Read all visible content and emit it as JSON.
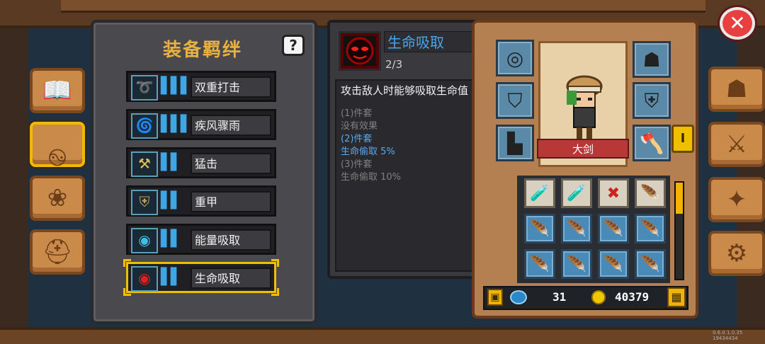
{
  "bond_panel": {
    "title": "装备羁绊",
    "help_label": "?",
    "bonds": [
      {
        "name": "双重打击",
        "icon": "bow-icon",
        "glyph": "➰",
        "bars": "▌▌▌",
        "color": "#e04030"
      },
      {
        "name": "疾风骤雨",
        "icon": "tornado-icon",
        "glyph": "🌀",
        "bars": "▌▌▌",
        "color": "#b060e0"
      },
      {
        "name": "猛击",
        "icon": "hammer-icon",
        "glyph": "⚒",
        "bars": "▌▌",
        "color": "#e0c060"
      },
      {
        "name": "重甲",
        "icon": "armor-icon",
        "glyph": "⛨",
        "bars": "▌▌",
        "color": "#c0a060"
      },
      {
        "name": "能量吸取",
        "icon": "energy-mask-icon",
        "glyph": "◉",
        "bars": "▌▌",
        "color": "#40c0e0"
      },
      {
        "name": "生命吸取",
        "icon": "life-mask-icon",
        "glyph": "◉",
        "bars": "▌▌",
        "color": "#e02020"
      }
    ],
    "selected_index": 5
  },
  "detail": {
    "name": "生命吸取",
    "count": "2/3",
    "description": "攻击敌人时能够吸取生命值",
    "tiers": [
      {
        "line": "(1)件套",
        "active": false
      },
      {
        "line": "没有效果",
        "active": false
      },
      {
        "line": "(2)件套",
        "active": true
      },
      {
        "line": "生命偷取 5%",
        "active": true
      },
      {
        "line": "(3)件套",
        "active": false
      },
      {
        "line": "生命偷取 10%",
        "active": false
      }
    ]
  },
  "hero": {
    "name": "大剑",
    "side_tab": "I"
  },
  "currency": {
    "gems": "31",
    "coins": "40379"
  },
  "close_label": "✕",
  "version": "0.6.0 1.0.35 19434434",
  "inventory": [
    {
      "icon": "health-potion-icon",
      "glyph": "🧪"
    },
    {
      "icon": "health-potion-icon",
      "glyph": "🧪"
    },
    {
      "icon": "scroll-icon",
      "glyph": "✖"
    },
    {
      "icon": "feather-icon",
      "glyph": "🪶"
    },
    {
      "icon": "feather-icon",
      "glyph": "🪶"
    },
    {
      "icon": "feather-icon",
      "glyph": "🪶"
    },
    {
      "icon": "feather-icon",
      "glyph": "🪶"
    },
    {
      "icon": "feather-icon",
      "glyph": "🪶"
    },
    {
      "icon": "feather-icon",
      "glyph": "🪶"
    },
    {
      "icon": "feather-icon",
      "glyph": "🪶"
    },
    {
      "icon": "feather-icon",
      "glyph": "🪶"
    },
    {
      "icon": "feather-icon",
      "glyph": "🪶"
    }
  ]
}
